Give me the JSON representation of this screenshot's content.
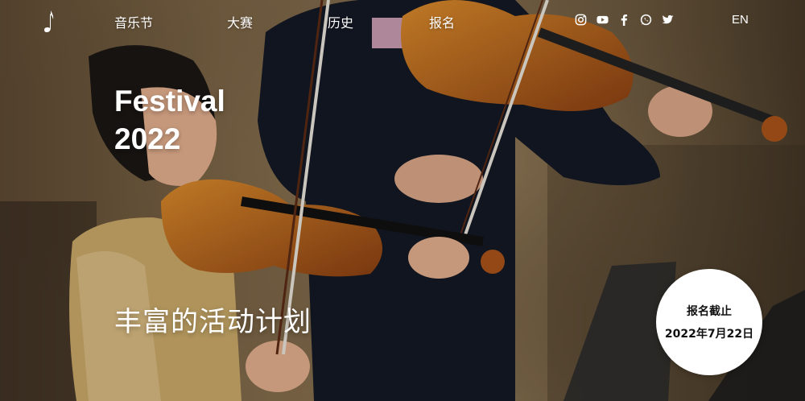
{
  "nav": {
    "logo": "music-note-logo",
    "items": [
      {
        "label": "音乐节"
      },
      {
        "label": "大赛"
      },
      {
        "label": "历史"
      },
      {
        "label": "报名"
      }
    ],
    "social": [
      "instagram-icon",
      "youtube-icon",
      "facebook-icon",
      "whatsapp-icon",
      "twitter-icon"
    ],
    "language": "EN"
  },
  "hero": {
    "title_line1": "Festival",
    "title_line2": "2022",
    "tagline": "丰富的活动计划"
  },
  "badge": {
    "line1": "报名截止",
    "line2": "2022年7月22日"
  },
  "colors": {
    "text": "#ffffff",
    "badge_bg": "#ffffff",
    "badge_text": "#111111"
  }
}
